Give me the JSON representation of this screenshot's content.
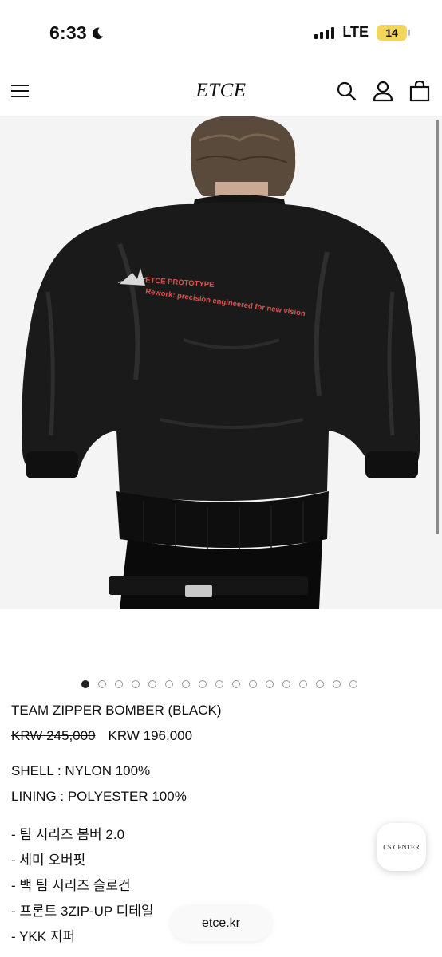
{
  "status_bar": {
    "time": "6:33",
    "network": "LTE",
    "battery": "14"
  },
  "header": {
    "logo": "ETCE"
  },
  "product_image": {
    "print_title": "ETCE PROTOTYPE",
    "print_subtitle": "Rework: precision engineered for new vision",
    "active_index": 1,
    "total_images": 17
  },
  "product": {
    "title": "TEAM ZIPPER BOMBER (BLACK)",
    "original_price": "KRW 245,000",
    "sale_price": "KRW 196,000",
    "specs": [
      "SHELL : NYLON 100%",
      "LINING : POLYESTER 100%"
    ],
    "description": [
      "- 팀 시리즈 봄버 2.0",
      "- 세미 오버핏",
      "- 백 팀 시리즈 슬로건",
      "- 프론트 3ZIP-UP 디테일",
      "- YKK 지퍼"
    ]
  },
  "cs_center": {
    "label": "CS CENTER"
  },
  "browser": {
    "url": "etce.kr"
  }
}
